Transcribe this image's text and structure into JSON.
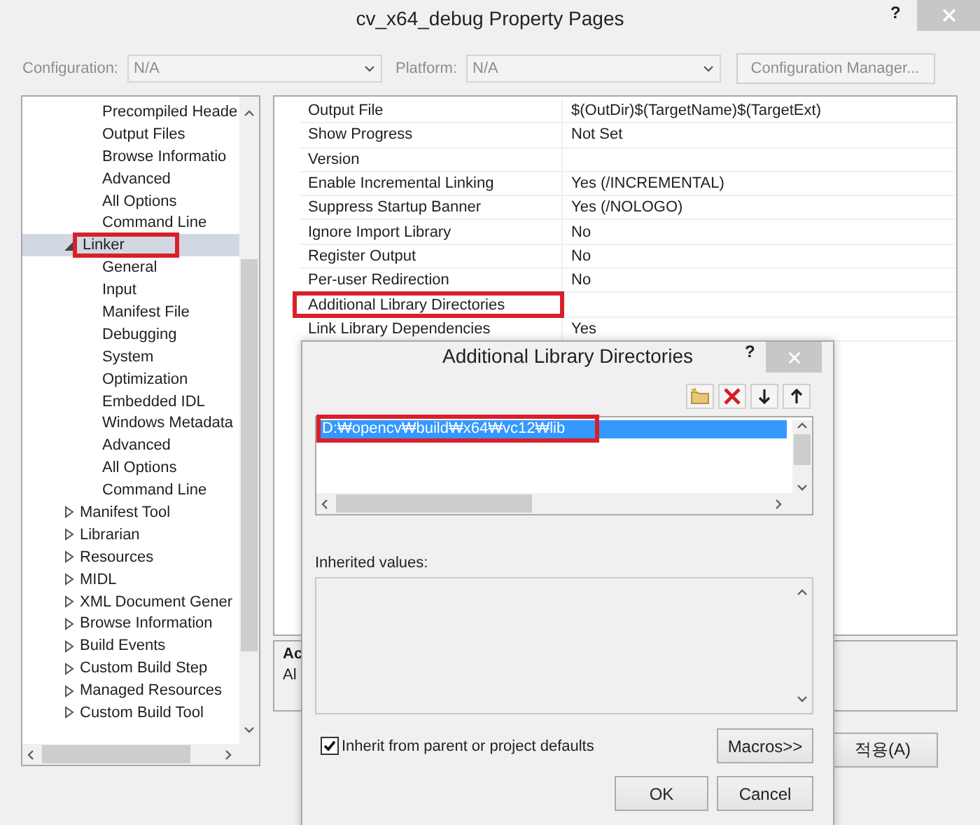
{
  "window": {
    "title": "cv_x64_debug Property Pages",
    "help": "?"
  },
  "config_bar": {
    "configuration_label": "Configuration:",
    "configuration_value": "N/A",
    "platform_label": "Platform:",
    "platform_value": "N/A",
    "manager_button": "Configuration Manager...",
    "disabled": true
  },
  "tree": [
    {
      "children": [
        {
          "label": "Precompiled Heade"
        },
        {
          "label": "Output Files"
        },
        {
          "label": "Browse Informatio"
        },
        {
          "label": "Advanced"
        },
        {
          "label": "All Options"
        },
        {
          "label": "Command Line"
        }
      ]
    },
    {
      "label": "Linker",
      "expanded": true,
      "selected": true,
      "highlighted": true,
      "children": [
        {
          "label": "General"
        },
        {
          "label": "Input"
        },
        {
          "label": "Manifest File"
        },
        {
          "label": "Debugging"
        },
        {
          "label": "System"
        },
        {
          "label": "Optimization"
        },
        {
          "label": "Embedded IDL"
        },
        {
          "label": "Windows Metadata"
        },
        {
          "label": "Advanced"
        },
        {
          "label": "All Options"
        },
        {
          "label": "Command Line"
        }
      ]
    },
    {
      "label": "Manifest Tool",
      "expanded": false,
      "selected": false
    },
    {
      "label": "Librarian",
      "expanded": false,
      "selected": false
    },
    {
      "label": "Resources",
      "expanded": false,
      "selected": false
    },
    {
      "label": "MIDL",
      "expanded": false,
      "selected": false
    },
    {
      "label": "XML Document Gener",
      "expanded": false,
      "selected": false
    },
    {
      "label": "Browse Information",
      "expanded": false,
      "selected": false
    },
    {
      "label": "Build Events",
      "expanded": false,
      "selected": false
    },
    {
      "label": "Custom Build Step",
      "expanded": false,
      "selected": false
    },
    {
      "label": "Managed Resources",
      "expanded": false,
      "selected": false
    },
    {
      "label": "Custom Build Tool",
      "expanded": false,
      "selected": false
    }
  ],
  "properties": [
    {
      "name": "Output File",
      "value": "$(OutDir)$(TargetName)$(TargetExt)",
      "highlighted": false
    },
    {
      "name": "Show Progress",
      "value": "Not Set",
      "highlighted": false
    },
    {
      "name": "Version",
      "highlighted": false
    },
    {
      "name": "Enable Incremental Linking",
      "value": "Yes (/INCREMENTAL)",
      "highlighted": false
    },
    {
      "name": "Suppress Startup Banner",
      "value": "Yes (/NOLOGO)",
      "highlighted": false
    },
    {
      "name": "Ignore Import Library",
      "value": "No",
      "highlighted": false
    },
    {
      "name": "Register Output",
      "value": "No",
      "highlighted": false
    },
    {
      "name": "Per-user Redirection",
      "value": "No",
      "highlighted": false
    },
    {
      "name": "Additional Library Directories",
      "highlighted": true
    },
    {
      "name": "Link Library Dependencies",
      "value": "Yes",
      "highlighted": false
    }
  ],
  "description": [
    "Ac",
    "Al"
  ],
  "footer_buttons": [
    "적용(A)"
  ],
  "dialog": {
    "title": "Additional Library Directories",
    "help": "?",
    "entries": [
      {
        "text": "D:₩opencv₩build₩x64₩vc12₩lib",
        "selected": true,
        "highlighted": true
      }
    ],
    "inherited_label": "Inherited values:",
    "inherit_checkbox": {
      "label": "Inherit from parent or project defaults",
      "checked": true
    },
    "macros_button": "Macros>>",
    "buttons": [
      "OK",
      "Cancel"
    ]
  }
}
